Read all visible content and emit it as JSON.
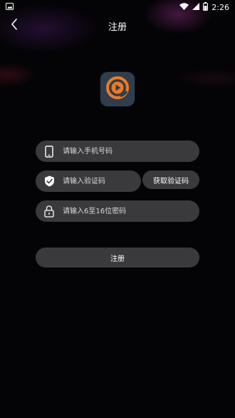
{
  "status_bar": {
    "time": "2:26",
    "icons": [
      "image-icon",
      "wifi-icon",
      "signal-icon",
      "battery-icon"
    ]
  },
  "header": {
    "title": "注册",
    "back_icon": "chevron-left-icon"
  },
  "logo": {
    "icon": "play-logo-icon",
    "colors": {
      "bg": "#2e3e4e",
      "accent": "#f07a22"
    }
  },
  "form": {
    "phone": {
      "placeholder": "请输入手机号码",
      "value": "",
      "icon": "phone-icon"
    },
    "code": {
      "placeholder": "请输入验证码",
      "value": "",
      "icon": "shield-check-icon"
    },
    "get_code_label": "获取验证码",
    "password": {
      "placeholder": "请输入6至16位密码",
      "value": "",
      "icon": "lock-icon"
    },
    "submit_label": "注册"
  },
  "colors": {
    "background": "#040306",
    "field": "#3a3a3d",
    "text": "#ffffff"
  }
}
